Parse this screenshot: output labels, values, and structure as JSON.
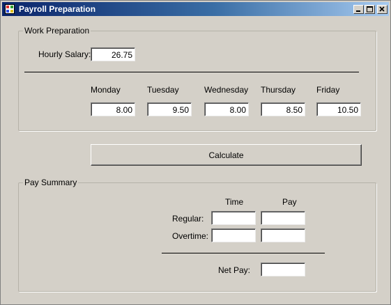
{
  "window": {
    "title": "Payroll Preparation",
    "titlebar_gradient": [
      "#0a246a",
      "#a6caf0"
    ]
  },
  "work_preparation": {
    "legend": "Work Preparation",
    "hourly_salary_label": "Hourly Salary:",
    "hourly_salary_value": "26.75",
    "days": [
      {
        "label": "Monday",
        "value": "8.00"
      },
      {
        "label": "Tuesday",
        "value": "9.50"
      },
      {
        "label": "Wednesday",
        "value": "8.00"
      },
      {
        "label": "Thursday",
        "value": "8.50"
      },
      {
        "label": "Friday",
        "value": "10.50"
      }
    ]
  },
  "calculate_button": "Calculate",
  "pay_summary": {
    "legend": "Pay Summary",
    "time_header": "Time",
    "pay_header": "Pay",
    "regular_label": "Regular:",
    "overtime_label": "Overtime:",
    "net_pay_label": "Net Pay:",
    "regular_time": "",
    "regular_pay": "",
    "overtime_time": "",
    "overtime_pay": "",
    "net_pay": ""
  }
}
